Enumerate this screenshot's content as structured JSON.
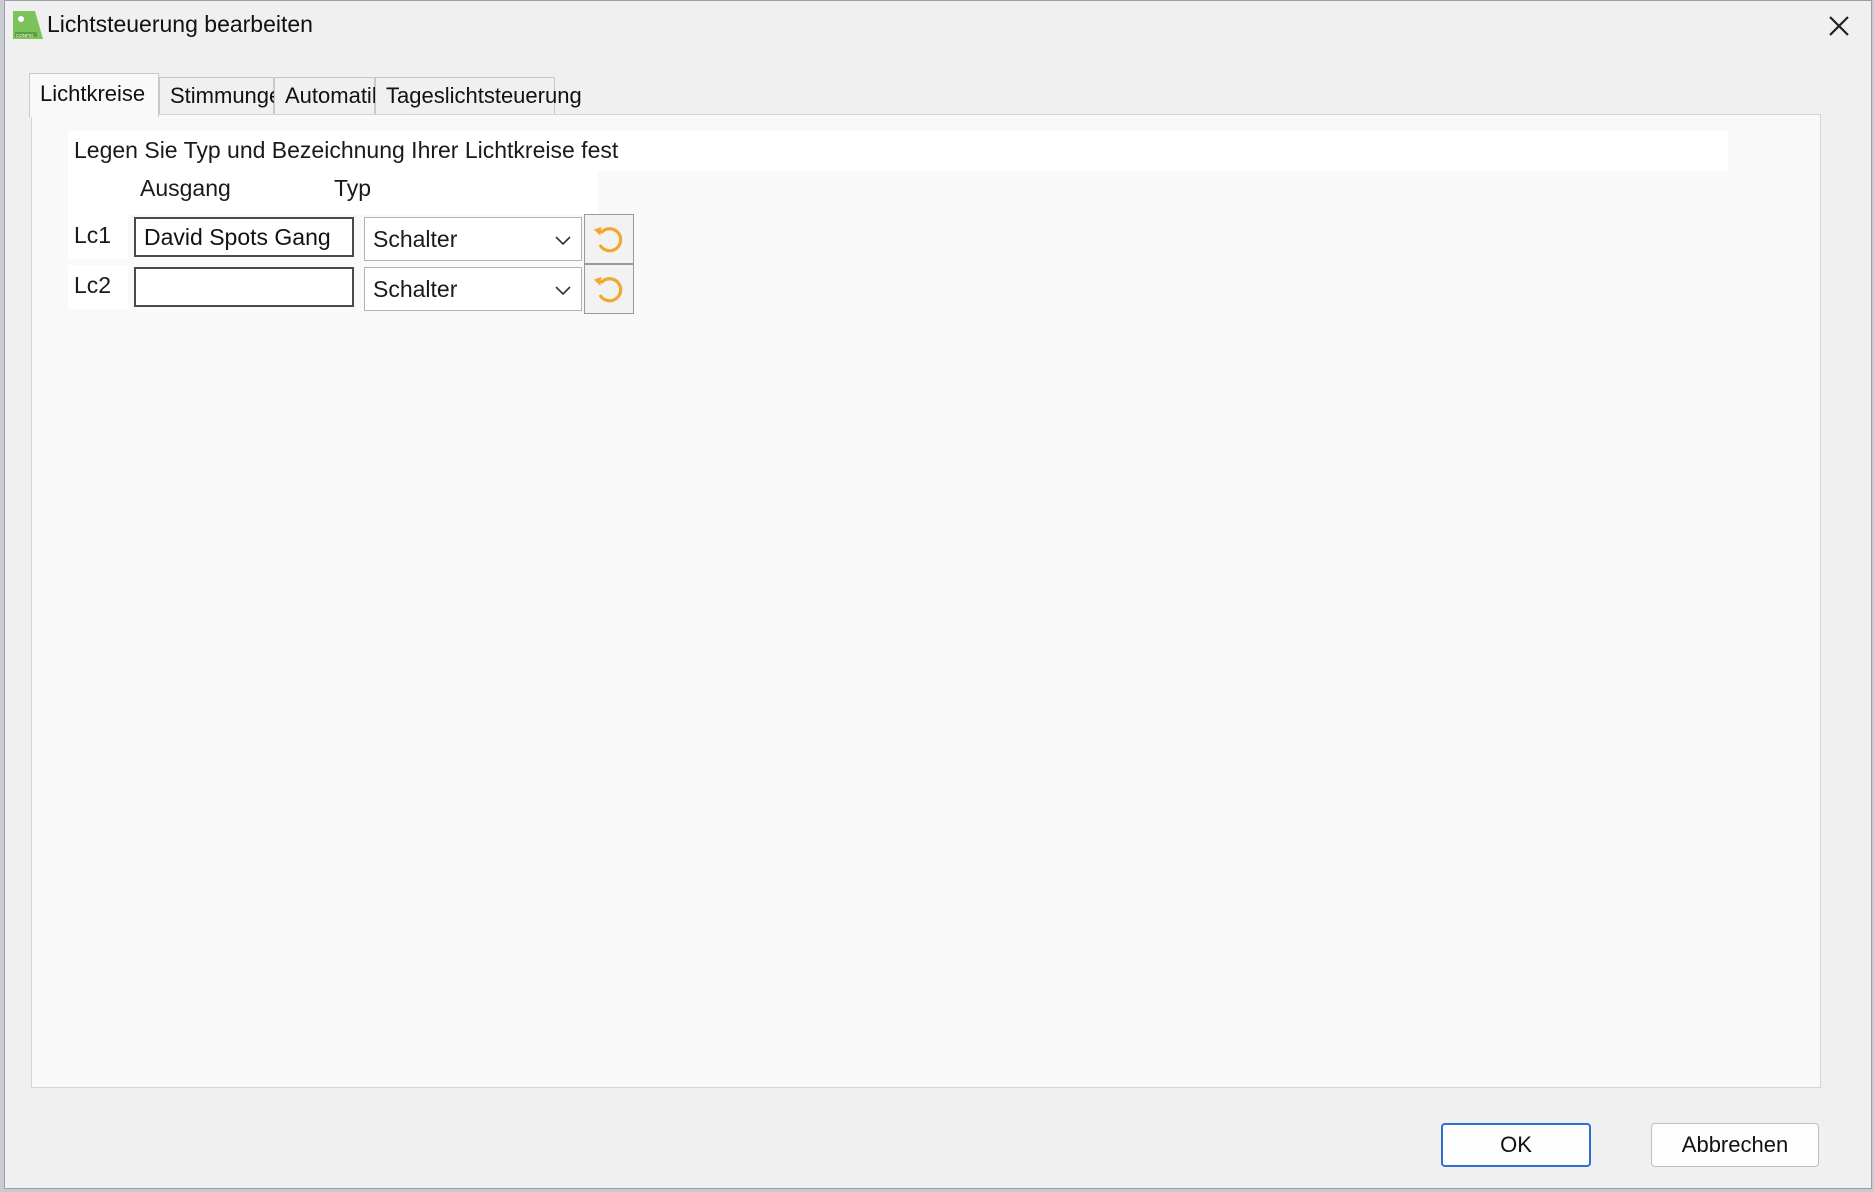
{
  "window": {
    "title": "Lichtsteuerung bearbeiten",
    "icon": "config-app-icon",
    "close_icon": "close-icon"
  },
  "tabs": [
    {
      "label": "Lichtkreise",
      "active": true
    },
    {
      "label": "Stimmungen",
      "active": false
    },
    {
      "label": "Automatik",
      "active": false
    },
    {
      "label": "Tageslichtsteuerung",
      "active": false
    }
  ],
  "panel": {
    "instruction": "Legen Sie Typ und Bezeichnung Ihrer Lichtkreise fest",
    "columns": {
      "output": "Ausgang",
      "type": "Typ"
    },
    "rows": [
      {
        "label": "Lc1",
        "output_value": "David Spots Gang",
        "type_value": "Schalter"
      },
      {
        "label": "Lc2",
        "output_value": "",
        "type_value": "Schalter"
      }
    ]
  },
  "footer": {
    "ok_label": "OK",
    "cancel_label": "Abbrechen"
  },
  "colors": {
    "reset_icon": "#f0a830",
    "primary_border": "#2f6fcf",
    "app_icon": "#7cc35a"
  }
}
